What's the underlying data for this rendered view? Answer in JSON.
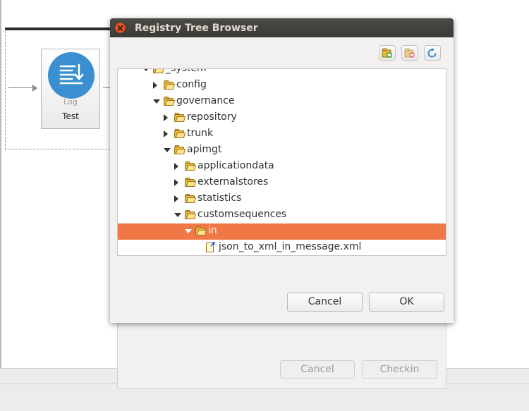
{
  "background": {
    "log_node": {
      "sublabel": "Log",
      "name": "Test",
      "icon": "log-icon"
    }
  },
  "underlying_dialog": {
    "cancel_label": "Cancel",
    "checkin_label": "Checkin"
  },
  "dialog": {
    "title": "Registry Tree Browser",
    "toolbar": [
      {
        "name": "add-resource-button",
        "icon": "add-resource-icon"
      },
      {
        "name": "delete-resource-button",
        "icon": "delete-resource-icon"
      },
      {
        "name": "refresh-button",
        "icon": "refresh-icon"
      }
    ],
    "tree": [
      {
        "label": "_system",
        "type": "folder",
        "state": "expanded",
        "depth": 0,
        "selected": false
      },
      {
        "label": "config",
        "type": "folder",
        "state": "collapsed",
        "depth": 1,
        "selected": false
      },
      {
        "label": "governance",
        "type": "folder",
        "state": "expanded",
        "depth": 1,
        "selected": false
      },
      {
        "label": "repository",
        "type": "folder",
        "state": "collapsed",
        "depth": 2,
        "selected": false
      },
      {
        "label": "trunk",
        "type": "folder",
        "state": "collapsed",
        "depth": 2,
        "selected": false
      },
      {
        "label": "apimgt",
        "type": "folder",
        "state": "expanded",
        "depth": 2,
        "selected": false
      },
      {
        "label": "applicationdata",
        "type": "folder",
        "state": "collapsed",
        "depth": 3,
        "selected": false
      },
      {
        "label": "externalstores",
        "type": "folder",
        "state": "collapsed",
        "depth": 3,
        "selected": false
      },
      {
        "label": "statistics",
        "type": "folder",
        "state": "collapsed",
        "depth": 3,
        "selected": false
      },
      {
        "label": "customsequences",
        "type": "folder",
        "state": "expanded",
        "depth": 3,
        "selected": false
      },
      {
        "label": "in",
        "type": "folder",
        "state": "expanded",
        "depth": 4,
        "selected": true
      },
      {
        "label": "json_to_xml_in_message.xml",
        "type": "file",
        "state": "leaf",
        "depth": 5,
        "selected": false
      }
    ],
    "cancel_label": "Cancel",
    "ok_label": "OK"
  },
  "colors": {
    "selection": "#f07746",
    "titlebar": "#3f3e3a",
    "close": "#e95420"
  }
}
